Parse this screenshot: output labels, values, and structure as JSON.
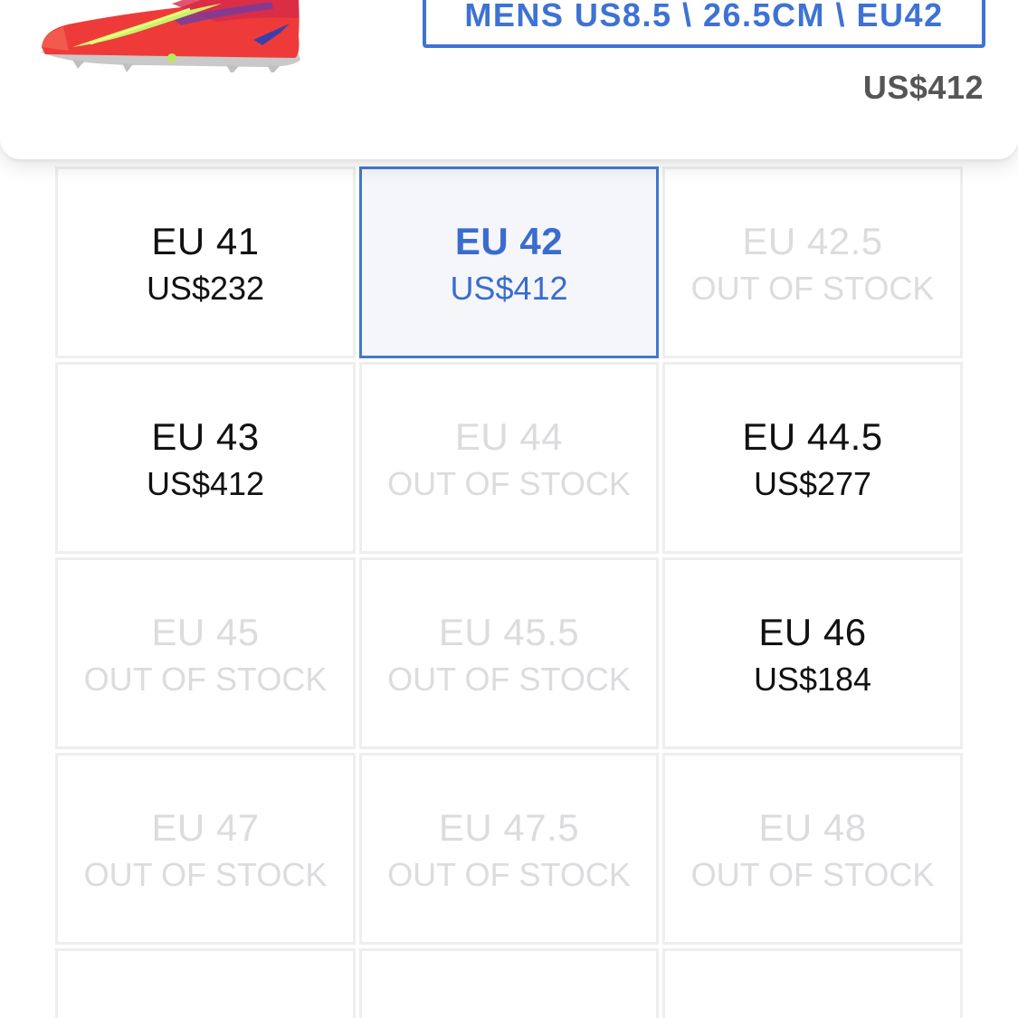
{
  "header": {
    "selected_size_label": "MENS US8.5 \\ 26.5CM \\ EU42",
    "price": "US$412"
  },
  "colors": {
    "accent": "#3e72d4",
    "out_of_stock_text": "#dcdcdf",
    "cell_border": "#eeeeef",
    "selected_bg": "#f4f6fa"
  },
  "sizes": [
    {
      "size": "EU 41",
      "price": "US$232",
      "status": "in_stock"
    },
    {
      "size": "EU 42",
      "price": "US$412",
      "status": "selected"
    },
    {
      "size": "EU 42.5",
      "price": "OUT OF STOCK",
      "status": "out_of_stock"
    },
    {
      "size": "EU 43",
      "price": "US$412",
      "status": "in_stock"
    },
    {
      "size": "EU 44",
      "price": "OUT OF STOCK",
      "status": "out_of_stock"
    },
    {
      "size": "EU 44.5",
      "price": "US$277",
      "status": "in_stock"
    },
    {
      "size": "EU 45",
      "price": "OUT OF STOCK",
      "status": "out_of_stock"
    },
    {
      "size": "EU 45.5",
      "price": "OUT OF STOCK",
      "status": "out_of_stock"
    },
    {
      "size": "EU 46",
      "price": "US$184",
      "status": "in_stock"
    },
    {
      "size": "EU 47",
      "price": "OUT OF STOCK",
      "status": "out_of_stock"
    },
    {
      "size": "EU 47.5",
      "price": "OUT OF STOCK",
      "status": "out_of_stock"
    },
    {
      "size": "EU 48",
      "price": "OUT OF STOCK",
      "status": "out_of_stock"
    }
  ]
}
